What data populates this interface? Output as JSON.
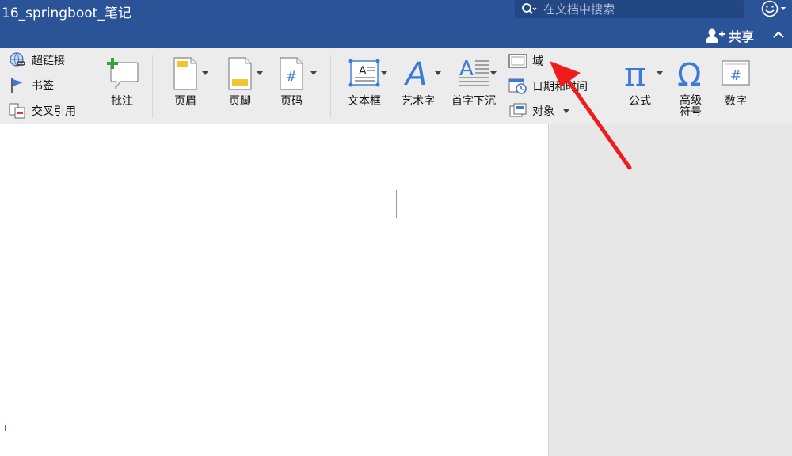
{
  "window": {
    "title": "16_springboot_笔记",
    "search_placeholder": "在文档中搜索",
    "share_label": "共享"
  },
  "ribbon": {
    "links_group": [
      {
        "label": "超链接",
        "icon": "hyperlink-icon"
      },
      {
        "label": "书签",
        "icon": "bookmark-flag-icon"
      },
      {
        "label": "交叉引用",
        "icon": "cross-reference-icon"
      }
    ],
    "comment_label": "批注",
    "header_label": "页眉",
    "footer_label": "页脚",
    "page_number_label": "页码",
    "text_box_label": "文本框",
    "wordart_label": "艺术字",
    "dropcap_label": "首字下沉",
    "field_label": "域",
    "datetime_label": "日期和时间",
    "object_label": "对象",
    "equation_label": "公式",
    "advanced_symbol_label": "高级\n符号",
    "number_label": "数字"
  },
  "colors": {
    "titlebar": "#2a5398",
    "ribbon": "#ececec",
    "accent_blue": "#3b7ad9",
    "annotation_arrow": "#f21b1b"
  }
}
